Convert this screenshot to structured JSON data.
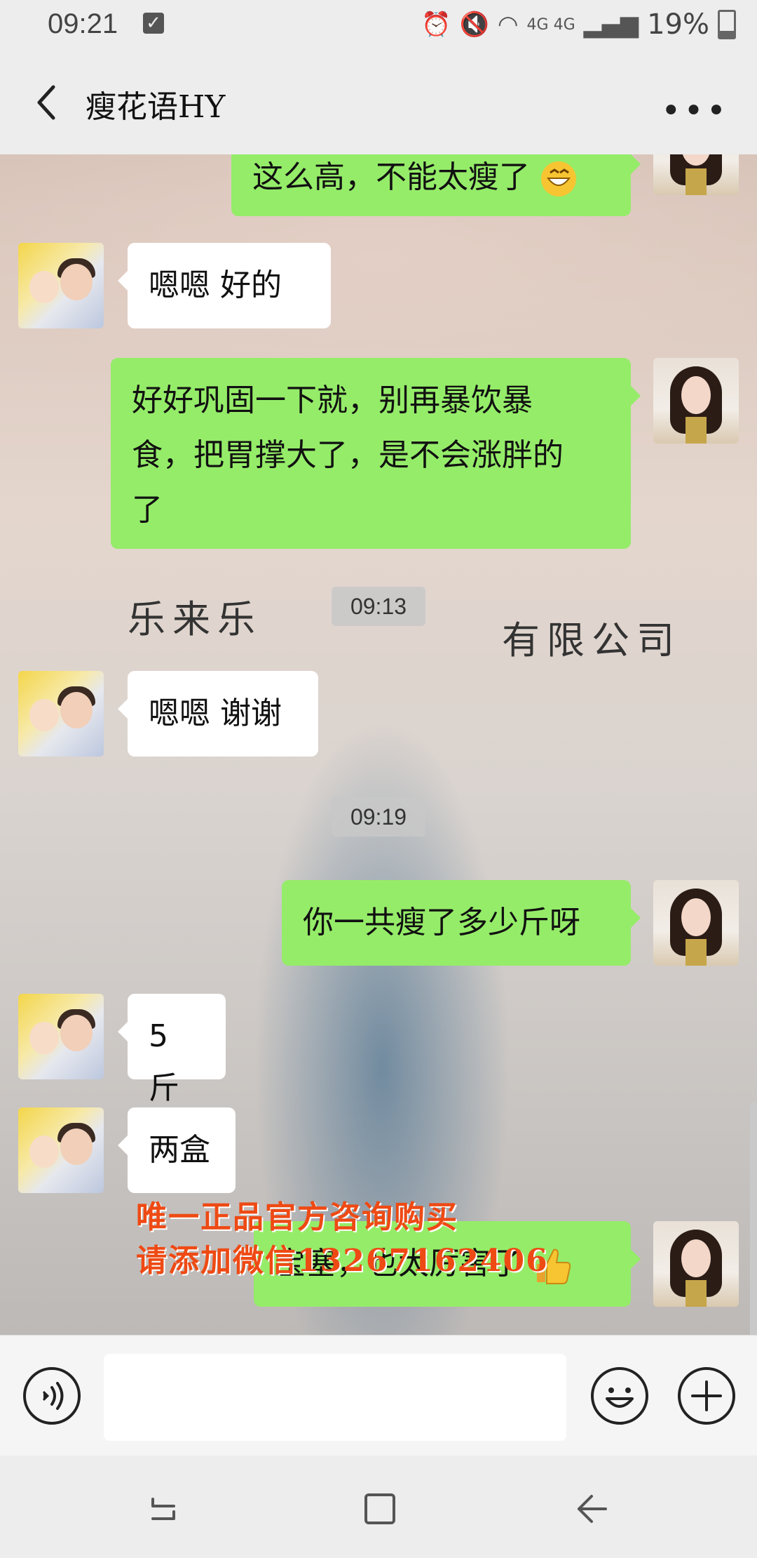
{
  "status": {
    "time": "09:21",
    "battery": "19%",
    "network": "4G 4G"
  },
  "header": {
    "title": "瘦花语HY"
  },
  "messages": [
    {
      "side": "out",
      "text": "这么高，不能太瘦了"
    },
    {
      "side": "in",
      "text": "嗯嗯 好的"
    },
    {
      "side": "out",
      "line1": "好好巩固一下就，别再暴饮暴",
      "line2": "食，把胃撑大了，是不会涨胖的",
      "line3": "了"
    },
    {
      "side": "in",
      "text": "嗯嗯 谢谢"
    },
    {
      "side": "out",
      "text": "你一共瘦了多少斤呀"
    },
    {
      "side": "in",
      "text": "5 斤"
    },
    {
      "side": "in",
      "text": "两盒"
    },
    {
      "side": "out",
      "text": "宝塞，也太厉害了"
    }
  ],
  "timestamps": [
    "09:13",
    "09:19"
  ],
  "background_text": {
    "left": "乐来乐",
    "right": "有限公司"
  },
  "watermark": {
    "line1": "唯一正品官方咨询购买",
    "line2": "请添加微信13267162406"
  },
  "icons": [
    "back-arrow-icon",
    "more-icon",
    "voice-icon",
    "emoji-icon",
    "plus-icon",
    "recents-icon",
    "home-icon",
    "back-nav-icon"
  ],
  "colors": {
    "out_bubble": "#95ec69",
    "in_bubble": "#ffffff",
    "watermark": "#ee4a14"
  }
}
